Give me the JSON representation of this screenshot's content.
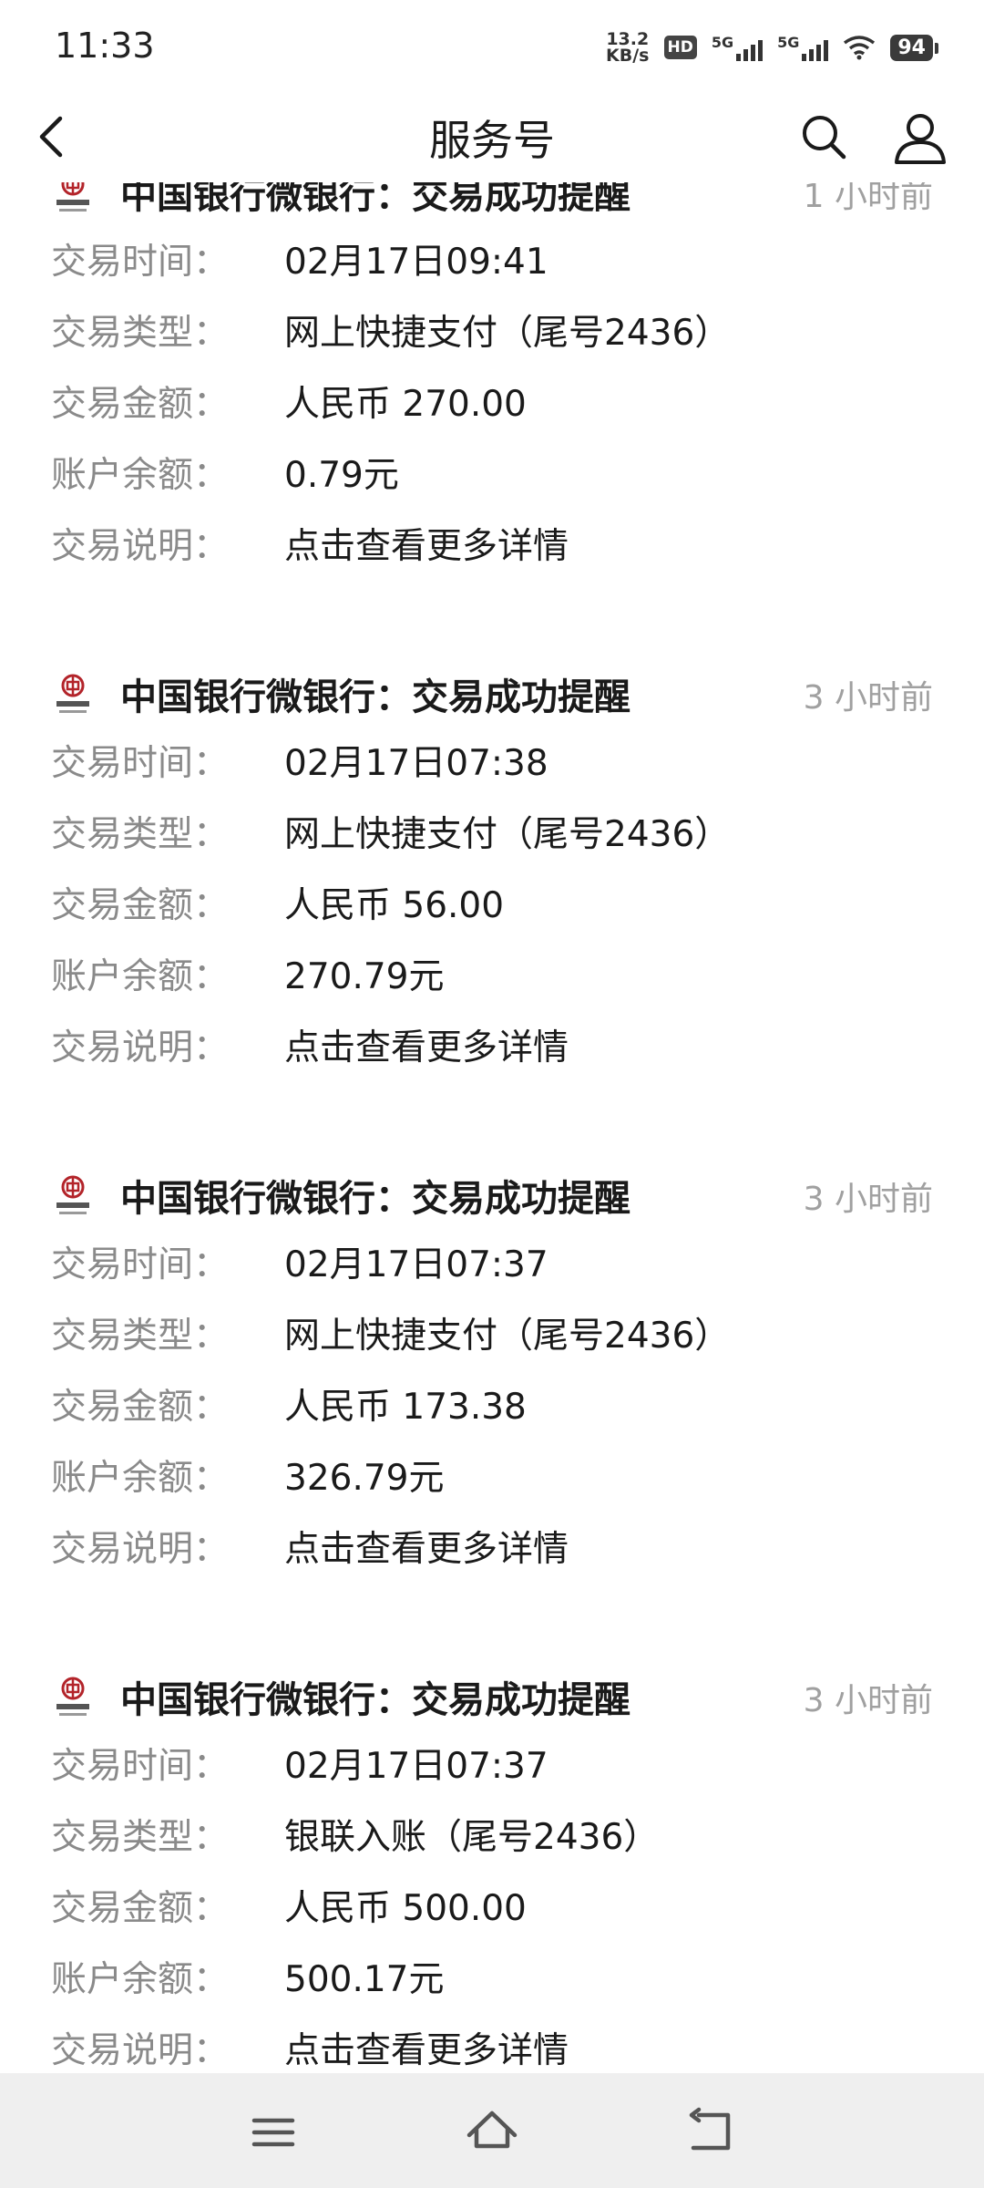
{
  "status": {
    "time": "11:33",
    "net_speed_value": "13.2",
    "net_speed_unit": "KB/s",
    "hd_badge": "HD",
    "sim1": "5G",
    "sim2": "5G",
    "battery": "94"
  },
  "header": {
    "title": "服务号"
  },
  "messages": [
    {
      "title": "中国银行微银行：交易成功提醒",
      "time": "1 小时前",
      "rows": [
        {
          "label": "交易时间：",
          "value": "02月17日09:41"
        },
        {
          "label": "交易类型：",
          "value": "网上快捷支付（尾号2436）"
        },
        {
          "label": "交易金额：",
          "value": "人民币 270.00"
        },
        {
          "label": "账户余额：",
          "value": "0.79元"
        },
        {
          "label": "交易说明：",
          "value": "点击查看更多详情"
        }
      ]
    },
    {
      "title": "中国银行微银行：交易成功提醒",
      "time": "3 小时前",
      "rows": [
        {
          "label": "交易时间：",
          "value": "02月17日07:38"
        },
        {
          "label": "交易类型：",
          "value": "网上快捷支付（尾号2436）"
        },
        {
          "label": "交易金额：",
          "value": "人民币 56.00"
        },
        {
          "label": "账户余额：",
          "value": "270.79元"
        },
        {
          "label": "交易说明：",
          "value": "点击查看更多详情"
        }
      ]
    },
    {
      "title": "中国银行微银行：交易成功提醒",
      "time": "3 小时前",
      "rows": [
        {
          "label": "交易时间：",
          "value": "02月17日07:37"
        },
        {
          "label": "交易类型：",
          "value": "网上快捷支付（尾号2436）"
        },
        {
          "label": "交易金额：",
          "value": "人民币 173.38"
        },
        {
          "label": "账户余额：",
          "value": "326.79元"
        },
        {
          "label": "交易说明：",
          "value": "点击查看更多详情"
        }
      ]
    },
    {
      "title": "中国银行微银行：交易成功提醒",
      "time": "3 小时前",
      "rows": [
        {
          "label": "交易时间：",
          "value": "02月17日07:37"
        },
        {
          "label": "交易类型：",
          "value": "银联入账（尾号2436）"
        },
        {
          "label": "交易金额：",
          "value": "人民币 500.00"
        },
        {
          "label": "账户余额：",
          "value": "500.17元"
        },
        {
          "label": "交易说明：",
          "value": "点击查看更多详情"
        }
      ]
    }
  ],
  "icons": {
    "back": "chevron-left-icon",
    "search": "search-icon",
    "profile": "person-icon",
    "bank_logo": "bank-of-china-logo",
    "nav_menu": "menu-icon",
    "nav_home": "home-icon",
    "nav_back": "back-icon"
  }
}
